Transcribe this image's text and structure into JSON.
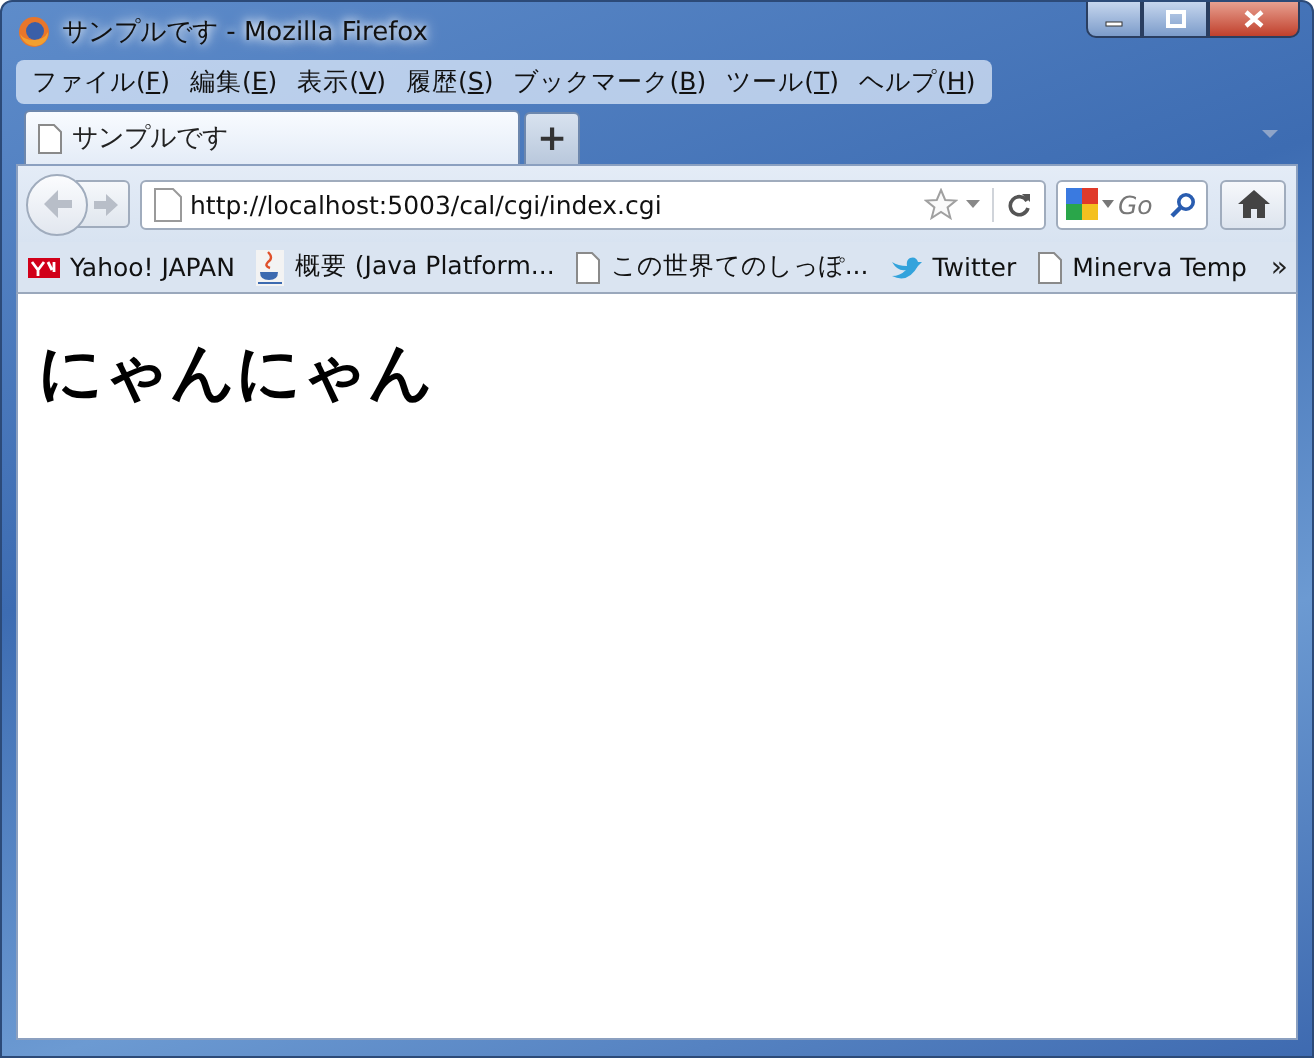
{
  "window": {
    "title": "サンプルです - Mozilla Firefox"
  },
  "menu": [
    {
      "before": "ファイル(",
      "key": "F",
      "after": ")"
    },
    {
      "before": "編集(",
      "key": "E",
      "after": ")"
    },
    {
      "before": "表示(",
      "key": "V",
      "after": ")"
    },
    {
      "before": "履歴(",
      "key": "S",
      "after": ")"
    },
    {
      "before": "ブックマーク(",
      "key": "B",
      "after": ")"
    },
    {
      "before": "ツール(",
      "key": "T",
      "after": ")"
    },
    {
      "before": "ヘルプ(",
      "key": "H",
      "after": ")"
    }
  ],
  "tabs": [
    {
      "label": "サンプルです",
      "selected": true
    }
  ],
  "new_tab": "+",
  "address_bar": {
    "value": "http://localhost:5003/cal/cgi/index.cgi"
  },
  "search": {
    "placeholder": "Go"
  },
  "bookmarks": [
    {
      "kind": "yahoo",
      "label": "Yahoo! JAPAN"
    },
    {
      "kind": "java",
      "label": "概要 (Java Platform..."
    },
    {
      "kind": "page",
      "label": "この世界てのしっぽ..."
    },
    {
      "kind": "twitter",
      "label": "Twitter"
    },
    {
      "kind": "page",
      "label": "Minerva Temp"
    }
  ],
  "bookmarks_overflow": "»",
  "page": {
    "heading": "にゃんにゃん"
  }
}
